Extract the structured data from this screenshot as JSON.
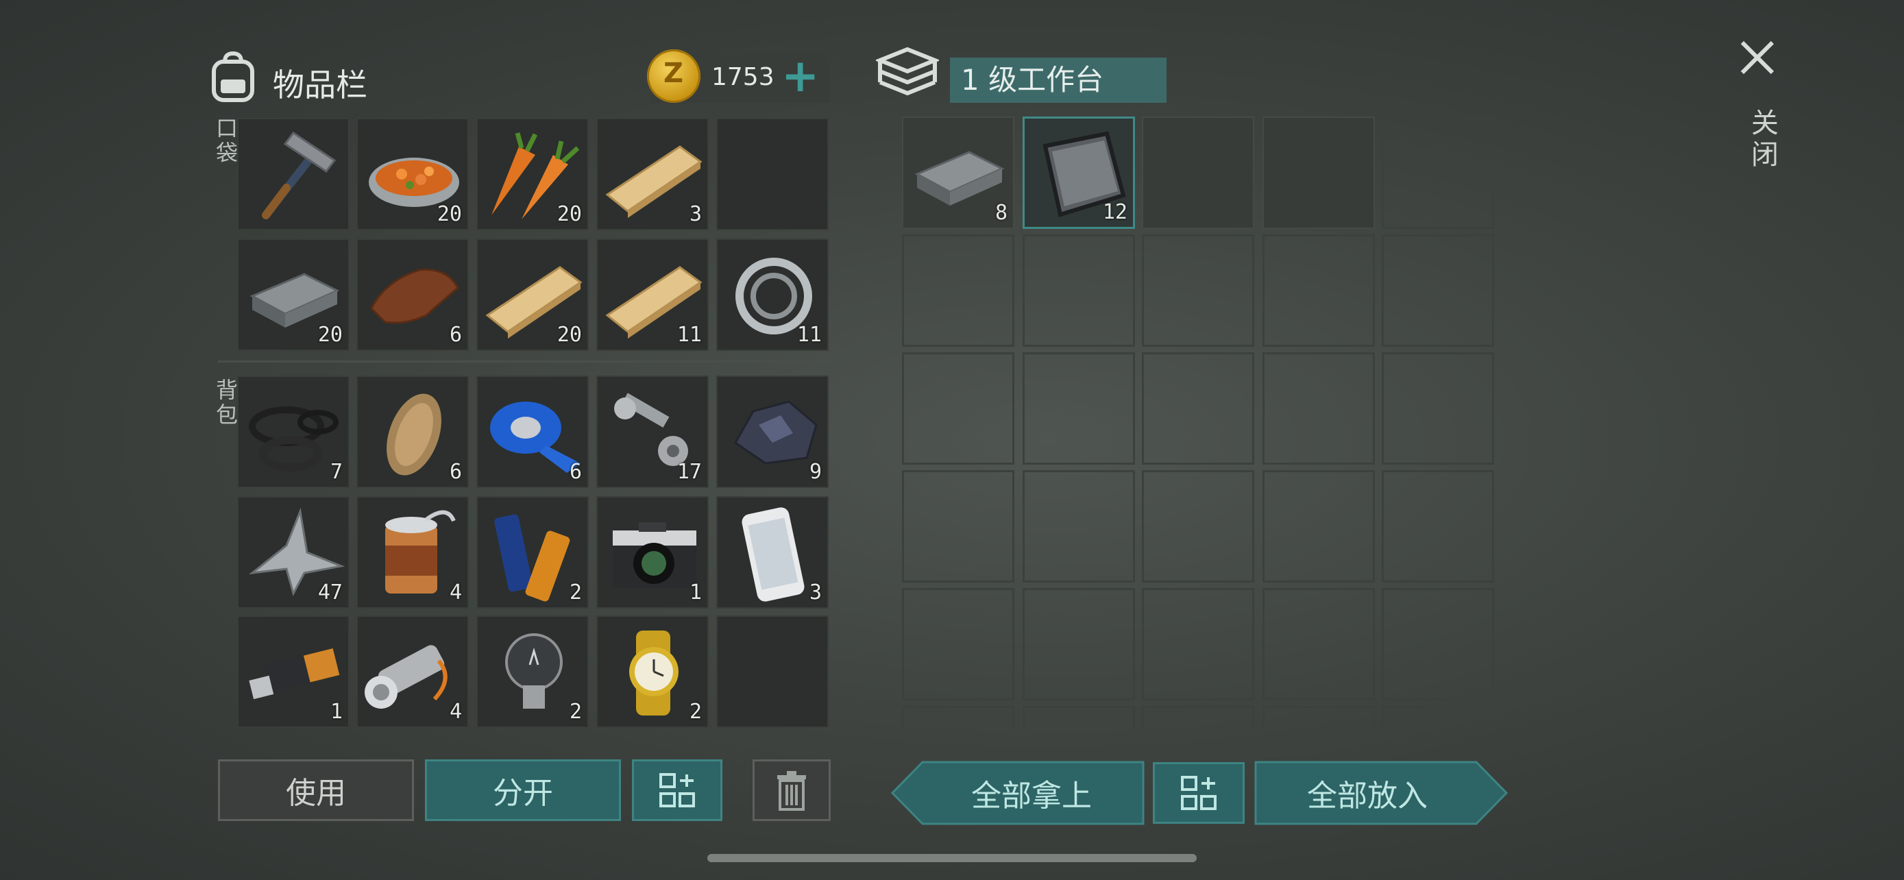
{
  "inventory": {
    "title": "物品栏",
    "coins": "1753",
    "add_symbol": "+",
    "pocket_label": "口袋",
    "backpack_label": "背包",
    "pocket": [
      {
        "icon": "hammer-icon",
        "count": ""
      },
      {
        "icon": "stew-bowl-icon",
        "count": "20"
      },
      {
        "icon": "carrot-icon",
        "count": "20"
      },
      {
        "icon": "wood-plank-icon",
        "count": "3"
      },
      {
        "icon": "",
        "count": ""
      },
      {
        "icon": "iron-ingot-icon",
        "count": "20"
      },
      {
        "icon": "leather-icon",
        "count": "6"
      },
      {
        "icon": "wood-plank-icon",
        "count": "20"
      },
      {
        "icon": "wood-plank-icon",
        "count": "11"
      },
      {
        "icon": "bearing-ring-icon",
        "count": "11"
      }
    ],
    "backpack": [
      {
        "icon": "rubber-seals-icon",
        "count": "7"
      },
      {
        "icon": "fur-icon",
        "count": "6"
      },
      {
        "icon": "blue-tape-icon",
        "count": "6"
      },
      {
        "icon": "bolt-nut-icon",
        "count": "17"
      },
      {
        "icon": "ore-icon",
        "count": "9"
      },
      {
        "icon": "scrap-metal-icon",
        "count": "47"
      },
      {
        "icon": "tin-can-icon",
        "count": "4"
      },
      {
        "icon": "battery-icon",
        "count": "2"
      },
      {
        "icon": "camera-icon",
        "count": "1"
      },
      {
        "icon": "phone-icon",
        "count": "3"
      },
      {
        "icon": "usb-drive-icon",
        "count": "1"
      },
      {
        "icon": "flashlight-icon",
        "count": "4"
      },
      {
        "icon": "light-bulb-icon",
        "count": "2"
      },
      {
        "icon": "gold-watch-icon",
        "count": "2"
      },
      {
        "icon": "",
        "count": ""
      }
    ],
    "buttons": {
      "use": "使用",
      "split": "分开"
    }
  },
  "workbench": {
    "title": "1 级工作台",
    "slots": [
      {
        "icon": "iron-ingot-icon",
        "count": "8"
      },
      {
        "icon": "steel-plate-icon",
        "count": "12"
      }
    ],
    "buttons": {
      "take_all": "全部拿上",
      "put_all": "全部放入"
    }
  },
  "close": {
    "label": "关闭"
  },
  "colors": {
    "accent": "#3e8483",
    "panel": "#2c2f2d",
    "background": "#454a46"
  }
}
